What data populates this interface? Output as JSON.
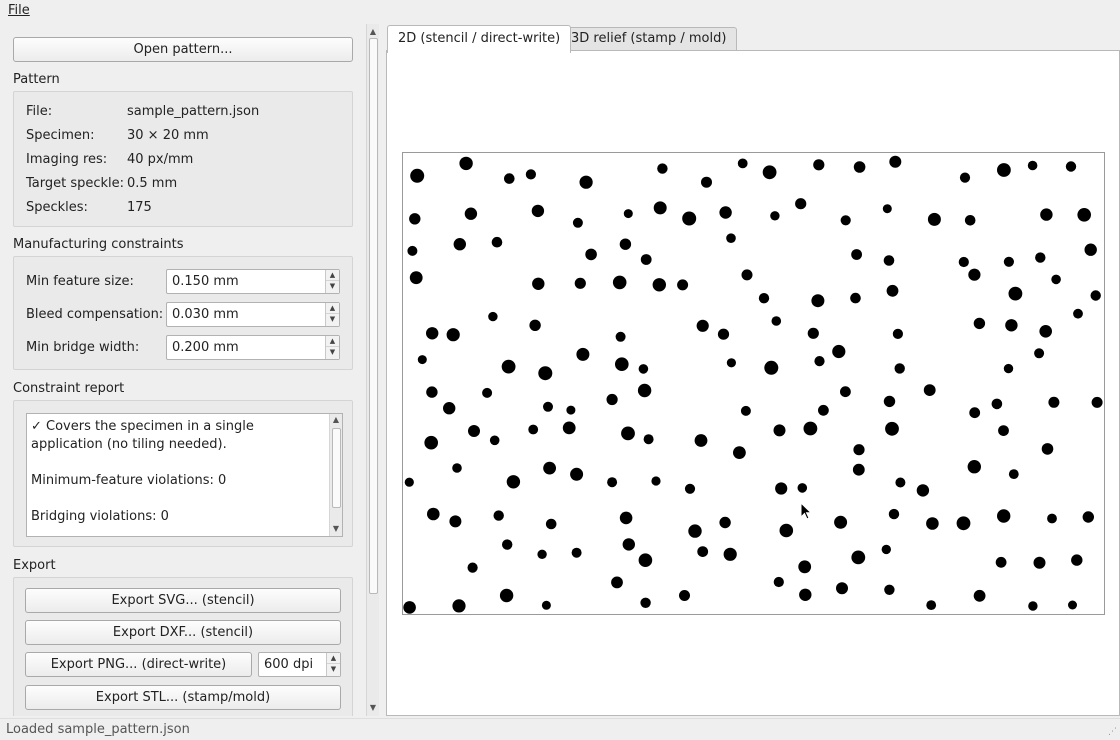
{
  "menu": {
    "file": "File"
  },
  "left": {
    "open_button": "Open pattern...",
    "pattern": {
      "title": "Pattern",
      "rows": [
        {
          "key": "File:",
          "value": "sample_pattern.json"
        },
        {
          "key": "Specimen:",
          "value": "30 × 20 mm"
        },
        {
          "key": "Imaging res:",
          "value": "40 px/mm"
        },
        {
          "key": "Target speckle:",
          "value": "0.5 mm"
        },
        {
          "key": "Speckles:",
          "value": "175"
        }
      ]
    },
    "constraints": {
      "title": "Manufacturing constraints",
      "min_feature_label": "Min feature size:",
      "min_feature_value": "0.150 mm",
      "bleed_label": "Bleed compensation:",
      "bleed_value": "0.030 mm",
      "bridge_label": "Min bridge width:",
      "bridge_value": "0.200 mm"
    },
    "report": {
      "title": "Constraint report",
      "text": "✓ Covers the specimen in a single application (no tiling needed).\n\nMinimum-feature violations: 0\n\nBridging violations: 0"
    },
    "export": {
      "title": "Export",
      "svg": "Export SVG... (stencil)",
      "dxf": "Export DXF... (stencil)",
      "png": "Export PNG... (direct-write)",
      "dpi": "600 dpi",
      "stl": "Export STL... (stamp/mold)"
    }
  },
  "tabs": [
    {
      "label": "2D (stencil / direct-write)",
      "active": true
    },
    {
      "label": "3D relief (stamp / mold)",
      "active": false
    }
  ],
  "status": {
    "text": "Loaded sample_pattern.json"
  }
}
